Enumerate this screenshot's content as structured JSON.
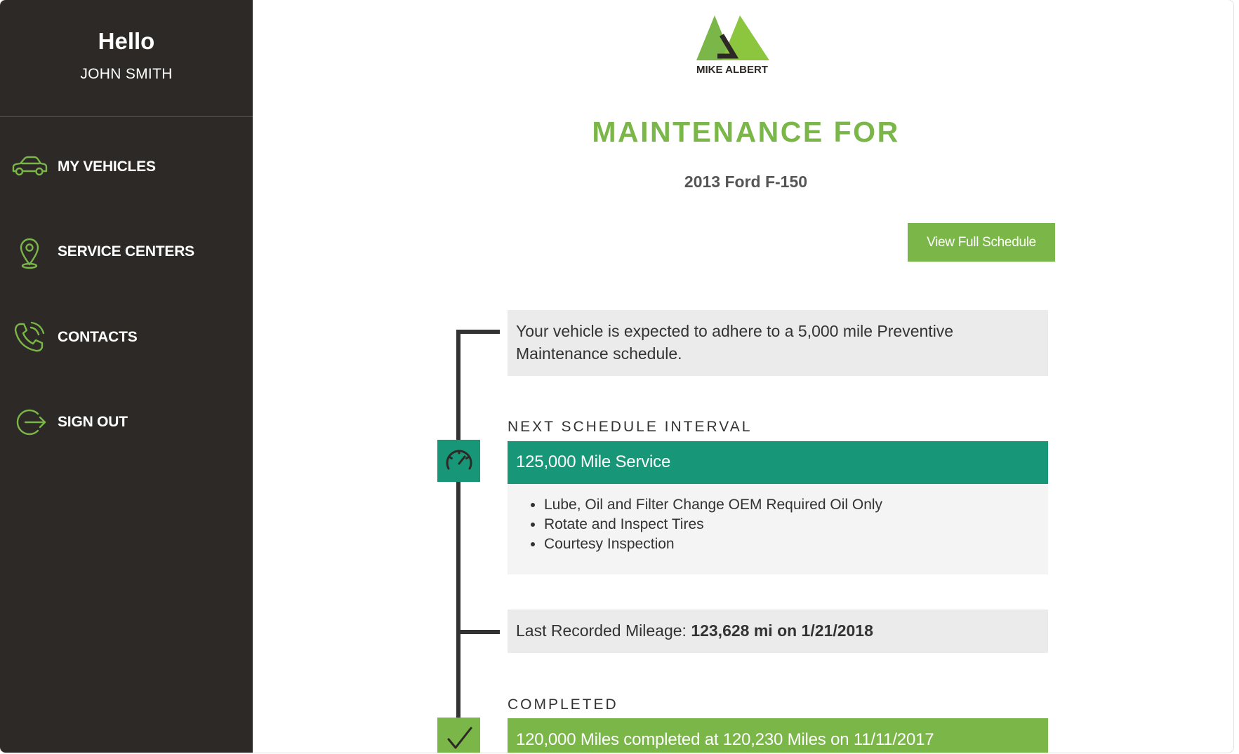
{
  "colors": {
    "sidebar_bg": "#2d2926",
    "brand_green": "#7ab648",
    "teal": "#179678",
    "panel_gray": "#ebebeb"
  },
  "sidebar": {
    "greeting": "Hello",
    "user_name": "JOHN SMITH",
    "items": [
      {
        "label": "MY VEHICLES",
        "icon": "car-icon"
      },
      {
        "label": "SERVICE CENTERS",
        "icon": "map-pin-icon"
      },
      {
        "label": "CONTACTS",
        "icon": "phone-icon"
      },
      {
        "label": "SIGN OUT",
        "icon": "sign-out-icon"
      }
    ]
  },
  "header": {
    "logo_text": "MIKE ALBERT",
    "title": "MAINTENANCE FOR",
    "vehicle": "2013 Ford F-150",
    "view_schedule_label": "View Full Schedule"
  },
  "schedule": {
    "info_text": "Your vehicle is expected to adhere to a 5,000 mile Preventive Maintenance schedule.",
    "next_heading": "NEXT SCHEDULE INTERVAL",
    "next_service": {
      "title": "125,000 Mile Service",
      "icon": "speedometer-icon",
      "tasks": [
        "Lube, Oil and Filter Change OEM Required Oil Only",
        "Rotate and Inspect Tires",
        "Courtesy Inspection"
      ]
    },
    "mileage": {
      "label": "Last Recorded Mileage: ",
      "value": "123,628 mi on 1/21/2018"
    },
    "completed_heading": "COMPLETED",
    "completed": {
      "title": "120,000 Miles completed at 120,230 Miles on 11/11/2017",
      "icon": "checkmark-icon"
    }
  }
}
